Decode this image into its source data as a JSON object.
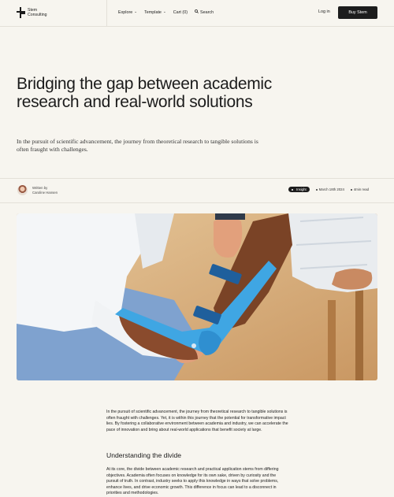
{
  "header": {
    "logo_line1": "Stem",
    "logo_line2": "Consulting",
    "nav": [
      {
        "label": "Explore",
        "has_chevron": true
      },
      {
        "label": "Template",
        "has_chevron": true
      },
      {
        "label": "Cart (0)",
        "has_chevron": false
      },
      {
        "label": "Search",
        "has_chevron": false
      }
    ],
    "login_label": "Log in",
    "buy_label": "Buy Stem"
  },
  "article": {
    "title": "Bridging the gap between academic research and real-world solutions",
    "subtitle": "In the pursuit of scientific advancement, the journey from theoretical research to tangible solutions is often fraught with challenges.",
    "written_by_label": "Written by",
    "author_name": "Caroline Hansen",
    "tag": "Insight",
    "date": "March 18th 2024",
    "read_time": "4min read",
    "paragraph1": "In the pursuit of scientific advancement, the journey from theoretical research to tangible solutions is often fraught with challenges. Yet, it is within this journey that the potential for transformative impact lies. By fostering a collaborative environment between academia and industry, we can accelerate the pace of innovation and bring about real-world applications that benefit society at large.",
    "section_heading": "Understanding the divide",
    "paragraph2": "At its core, the divide between academic research and practical application stems from differing objectives. Academia often focuses on knowledge for its own sake, driven by curiosity and the pursuit of truth. In contrast, industry seeks to apply this knowledge in ways that solve problems, enhance lives, and drive economic growth. This difference in focus can lead to a disconnect in priorities and methodologies."
  },
  "colors": {
    "background": "#f7f5ef",
    "button_dark": "#1d1d1d",
    "brace_blue": "#3fa6e3"
  },
  "icons": [
    "logo-mark-icon",
    "chevron-down-icon",
    "search-icon",
    "dot-icon"
  ]
}
